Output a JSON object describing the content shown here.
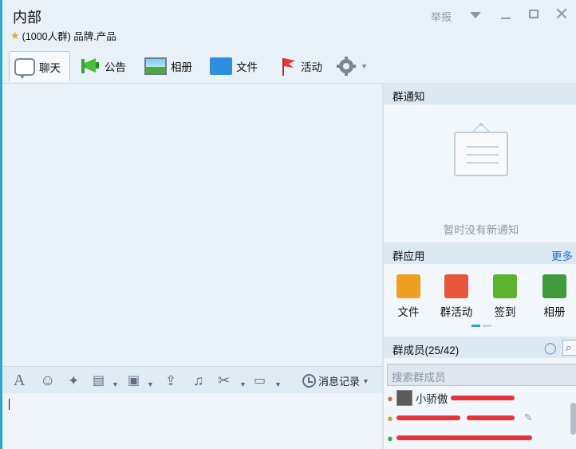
{
  "window": {
    "title": "内部",
    "subtitle": "(1000人群) 品牌.产品",
    "report_label": "举报"
  },
  "tabs": [
    {
      "label": "聊天",
      "icon": "chat-bubble-icon",
      "active": true
    },
    {
      "label": "公告",
      "icon": "megaphone-icon"
    },
    {
      "label": "相册",
      "icon": "photo-icon"
    },
    {
      "label": "文件",
      "icon": "folder-icon"
    },
    {
      "label": "活动",
      "icon": "flag-icon"
    }
  ],
  "toolbar": {
    "history_label": "消息记录"
  },
  "notice": {
    "header": "群通知",
    "empty_text": "暂时没有新通知"
  },
  "apps": {
    "header": "群应用",
    "more_label": "更多",
    "items": [
      {
        "label": "文件",
        "color": "#f0a020"
      },
      {
        "label": "群活动",
        "color": "#e8573c"
      },
      {
        "label": "签到",
        "color": "#5cb32e"
      },
      {
        "label": "相册",
        "color": "#3e9a3a"
      }
    ]
  },
  "members": {
    "header": "群成员(25/42)",
    "search_placeholder": "搜索群成员",
    "list": [
      {
        "name": "小骄傲"
      },
      {
        "name": ""
      },
      {
        "name": ""
      }
    ]
  },
  "colors": {
    "accent": "#2aa7c9",
    "link": "#1d6fcf",
    "redact": "#e5333a"
  }
}
